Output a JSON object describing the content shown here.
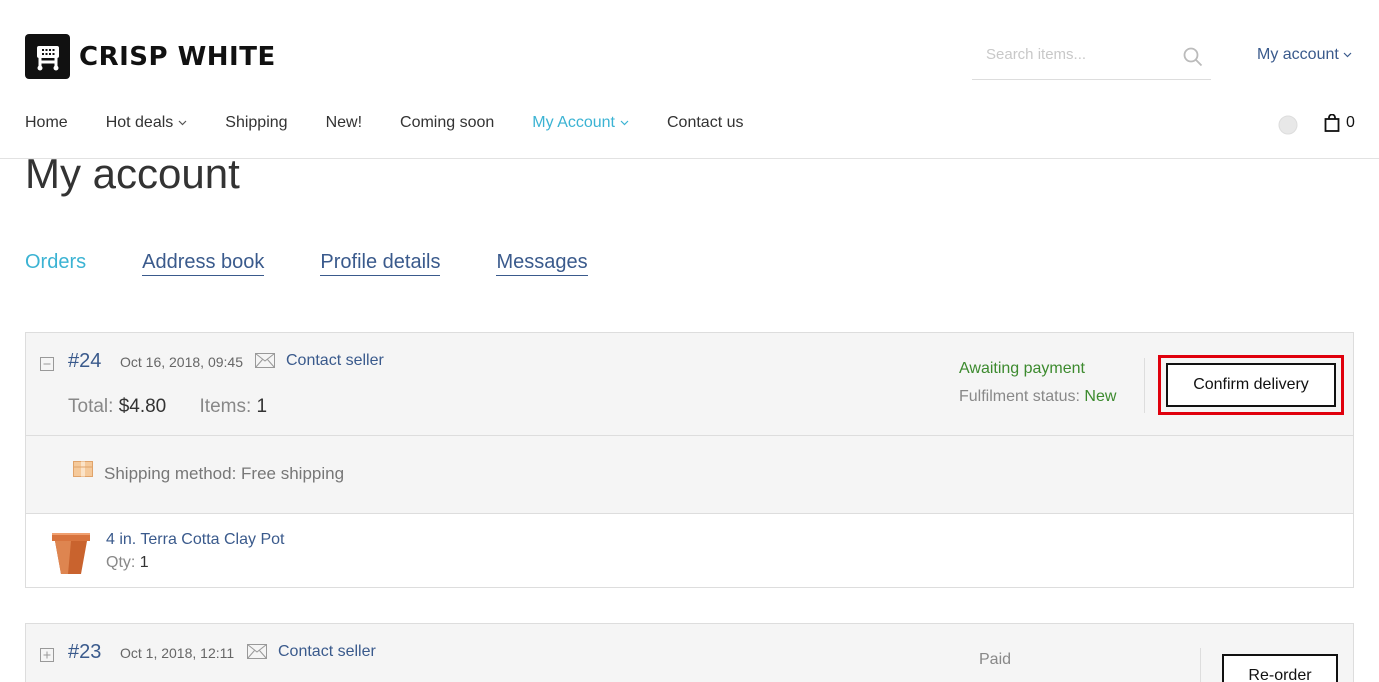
{
  "header": {
    "brand": "CRISP WHITE",
    "search_placeholder": "Search items...",
    "account_link": "My account",
    "cart_count": "0"
  },
  "nav": [
    {
      "label": "Home"
    },
    {
      "label": "Hot deals"
    },
    {
      "label": "Shipping"
    },
    {
      "label": "New!"
    },
    {
      "label": "Coming soon"
    },
    {
      "label": "My Account"
    },
    {
      "label": "Contact us"
    }
  ],
  "page": {
    "title": "My account",
    "tabs": [
      {
        "label": "Orders"
      },
      {
        "label": "Address book"
      },
      {
        "label": "Profile details"
      },
      {
        "label": "Messages"
      }
    ]
  },
  "orders": [
    {
      "number": "#24",
      "date": "Oct 16, 2018, 09:45",
      "contact": "Contact seller",
      "total_label": "Total:",
      "total": "$4.80",
      "items_label": "Items:",
      "items": "1",
      "payment_status": "Awaiting payment",
      "fulfilment_label": "Fulfilment status:",
      "fulfilment_status": "New",
      "action": "Confirm delivery",
      "shipping": "Shipping method: Free shipping",
      "product_name": "4 in. Terra Cotta Clay Pot",
      "qty_label": "Qty:",
      "qty": "1"
    },
    {
      "number": "#23",
      "date": "Oct 1, 2018, 12:11",
      "contact": "Contact seller",
      "payment_status": "Paid",
      "action": "Re-order"
    }
  ],
  "colors": {
    "link": "#3a5a8c",
    "active": "#3bb3d3",
    "success": "#3c8a2e",
    "highlight": "#e0000d"
  }
}
